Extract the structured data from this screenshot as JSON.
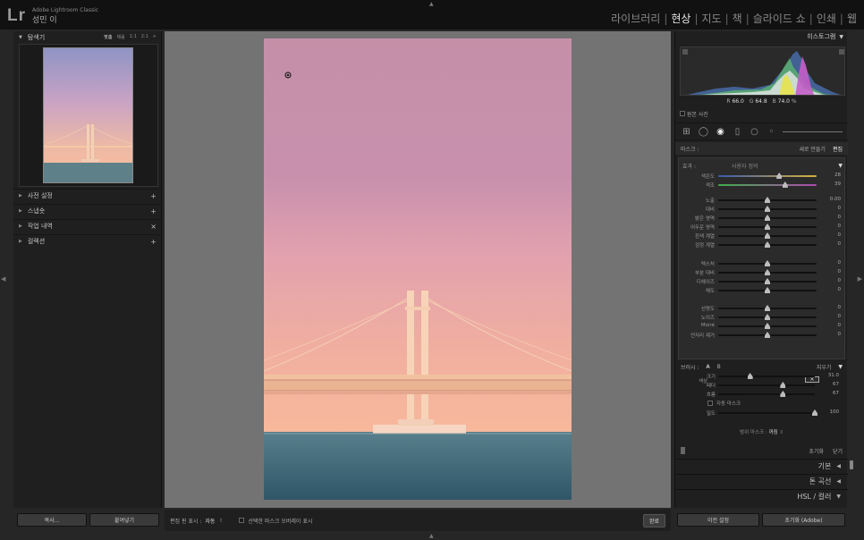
{
  "app": {
    "logo": "Lr",
    "product": "Adobe Lightroom Classic",
    "user": "성민 이"
  },
  "modules": [
    "라이브러리",
    "현상",
    "지도",
    "책",
    "슬라이드 쇼",
    "인쇄",
    "웹"
  ],
  "active_module": "현상",
  "left": {
    "navigator": {
      "title": "탐색기",
      "zoom_options": [
        "맞춤",
        "채움",
        "1:1",
        "2:1",
        "+"
      ]
    },
    "sections": [
      {
        "label": "사전 설정",
        "action": "+"
      },
      {
        "label": "스냅숏",
        "action": "+"
      },
      {
        "label": "작업 내역",
        "action": "×"
      },
      {
        "label": "컬렉션",
        "action": "+"
      }
    ],
    "copy_label": "복사...",
    "paste_label": "붙여넣기"
  },
  "toolbar": {
    "show_edit_pins_label": "편집 핀 표시 :",
    "show_edit_pins_value": "자동",
    "overlay_label": "선택한 마스크 오버레이 표시",
    "done_label": "완료"
  },
  "right": {
    "histogram_title": "히스토그램",
    "readout": {
      "r_label": "R",
      "r": "66.0",
      "g_label": "G",
      "g": "64.8",
      "b_label": "B",
      "b": "74.0",
      "unit": "%"
    },
    "original_photo": "원본 사진",
    "mask_label": "마스크 :",
    "new_label": "새로 만들기",
    "edit_label": "편집",
    "effect_label": "효과 :",
    "effect_value": "사용자 정의",
    "sliders_top": [
      {
        "label": "색온도",
        "value": "28",
        "pos": 0.62
      },
      {
        "label": "색조",
        "value": "39",
        "pos": 0.68
      }
    ],
    "sliders_group1": [
      {
        "label": "노출",
        "value": "0.00",
        "pos": 0.5
      },
      {
        "label": "대비",
        "value": "0",
        "pos": 0.5
      },
      {
        "label": "밝은 영역",
        "value": "0",
        "pos": 0.5
      },
      {
        "label": "어두운 영역",
        "value": "0",
        "pos": 0.5
      },
      {
        "label": "흰색 계열",
        "value": "0",
        "pos": 0.5
      },
      {
        "label": "검정 계열",
        "value": "0",
        "pos": 0.5
      }
    ],
    "sliders_group2": [
      {
        "label": "텍스처",
        "value": "0",
        "pos": 0.5
      },
      {
        "label": "부분 대비",
        "value": "0",
        "pos": 0.5
      },
      {
        "label": "디헤이즈",
        "value": "0",
        "pos": 0.5
      },
      {
        "label": "채도",
        "value": "0",
        "pos": 0.5
      }
    ],
    "sliders_group3": [
      {
        "label": "선명도",
        "value": "0",
        "pos": 0.5
      },
      {
        "label": "노이즈",
        "value": "0",
        "pos": 0.5
      },
      {
        "label": "Moiré",
        "value": "0",
        "pos": 0.5
      },
      {
        "label": "언저리 제거",
        "value": "0",
        "pos": 0.5
      }
    ],
    "color_label": "색상",
    "brush_label": "브러시 :",
    "brush_a": "A",
    "brush_b": "B",
    "erase_label": "지우기",
    "brush_sliders": [
      {
        "label": "크기",
        "value": "31.0",
        "pos": 0.33
      },
      {
        "label": "페더",
        "value": "67",
        "pos": 0.67
      },
      {
        "label": "흐름",
        "value": "67",
        "pos": 0.67
      }
    ],
    "auto_mask_label": "자동 마스크",
    "density": {
      "label": "밀도",
      "value": "100",
      "pos": 1.0
    },
    "range_mask_label": "범위 마스크 :",
    "range_mask_value": "꺼짐",
    "reset_label": "초기화",
    "close_label": "닫기",
    "panels": [
      {
        "label": "기본",
        "arrow": "◀"
      },
      {
        "label": "톤 곡선",
        "arrow": "◀"
      },
      {
        "label": "HSL / 컬러",
        "arrow": "▼"
      }
    ],
    "prev_label": "이전 설정",
    "reset_adobe_label": "초기화 (Adobe)"
  }
}
